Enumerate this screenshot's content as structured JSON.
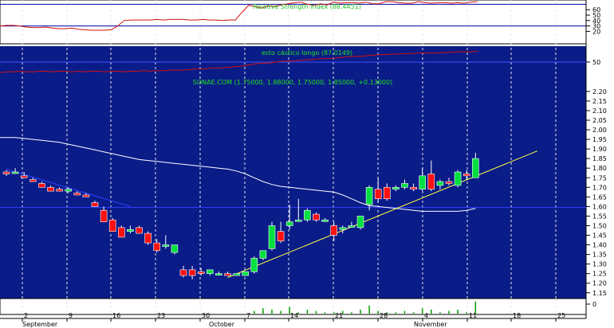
{
  "chart_data": [
    {
      "type": "line",
      "title": "Relative Strength Index (88.4451)",
      "ylim": [
        0,
        75
      ],
      "yticks": [
        20,
        30,
        40,
        50,
        60
      ],
      "reference_lines": [
        30,
        70
      ],
      "series": [
        {
          "values": [
            30,
            31,
            31,
            30,
            28,
            27,
            27,
            28,
            26,
            25,
            25,
            26,
            24,
            23,
            22,
            22,
            22,
            23,
            30,
            40,
            41,
            41,
            41,
            41,
            42,
            41,
            42,
            42,
            42,
            41,
            41,
            42,
            41,
            41,
            40,
            41,
            41,
            55,
            68,
            66,
            63,
            67,
            66,
            69,
            71,
            73,
            74,
            70,
            68,
            71,
            69,
            74,
            72,
            73,
            73,
            72,
            74,
            71,
            71,
            75,
            75,
            73,
            72,
            72,
            75,
            73,
            72,
            73,
            73,
            72,
            73,
            72,
            74,
            75
          ]
        }
      ]
    },
    {
      "type": "line",
      "title": "esto cástico longo (87.0149)",
      "ylim": [
        25,
        75
      ],
      "yticks": [
        50
      ],
      "series": [
        {
          "values": [
            32,
            33,
            33,
            34,
            33,
            33,
            34,
            34,
            33,
            34,
            34,
            33,
            34,
            33,
            34,
            34,
            33,
            34,
            34,
            33,
            34,
            34,
            35,
            34,
            35,
            35,
            36,
            36,
            36,
            37,
            38,
            38,
            39,
            40,
            40,
            41,
            42,
            43,
            45,
            47,
            48,
            48,
            50,
            51,
            52,
            52,
            53,
            54,
            55,
            56,
            56,
            57,
            58,
            59,
            60,
            60,
            61,
            62,
            63,
            63,
            64,
            64,
            65,
            65,
            66,
            66,
            66,
            66,
            67,
            67,
            68,
            68,
            68,
            69
          ]
        }
      ]
    },
    {
      "type": "candlestick",
      "title": "SONAE.COM (1.75000, 1.88000, 1.75000, 1.85000, +0.13000)",
      "ylim": [
        1.12,
        2.27
      ],
      "yticks": [
        "2.20",
        "2.15",
        "2.10",
        "2.05",
        "2.00",
        "1.95",
        "1.90",
        "1.85",
        "1.80",
        "1.75",
        "1.70",
        "1.65",
        "1.60",
        "1.55",
        "1.50",
        "1.45",
        "1.40",
        "1.35",
        "1.30",
        "1.25",
        "1.20",
        "1.15"
      ],
      "x_ticks": [
        "2",
        "9",
        "16",
        "23",
        "30",
        "7",
        "14",
        "21",
        "28",
        "4",
        "11",
        "18",
        "25"
      ],
      "months": [
        "September",
        "October",
        "November"
      ],
      "candles": [
        {
          "o": 1.78,
          "h": 1.79,
          "l": 1.76,
          "c": 1.77
        },
        {
          "o": 1.78,
          "h": 1.8,
          "l": 1.77,
          "c": 1.78
        },
        {
          "o": 1.76,
          "h": 1.78,
          "l": 1.75,
          "c": 1.75
        },
        {
          "o": 1.74,
          "h": 1.75,
          "l": 1.73,
          "c": 1.73
        },
        {
          "o": 1.72,
          "h": 1.73,
          "l": 1.7,
          "c": 1.7
        },
        {
          "o": 1.7,
          "h": 1.71,
          "l": 1.68,
          "c": 1.68
        },
        {
          "o": 1.69,
          "h": 1.7,
          "l": 1.68,
          "c": 1.68
        },
        {
          "o": 1.68,
          "h": 1.7,
          "l": 1.67,
          "c": 1.69
        },
        {
          "o": 1.67,
          "h": 1.68,
          "l": 1.66,
          "c": 1.66
        },
        {
          "o": 1.66,
          "h": 1.67,
          "l": 1.65,
          "c": 1.65
        },
        {
          "o": 1.62,
          "h": 1.63,
          "l": 1.6,
          "c": 1.6
        },
        {
          "o": 1.58,
          "h": 1.6,
          "l": 1.52,
          "c": 1.52
        },
        {
          "o": 1.53,
          "h": 1.54,
          "l": 1.47,
          "c": 1.47
        },
        {
          "o": 1.49,
          "h": 1.5,
          "l": 1.44,
          "c": 1.44
        },
        {
          "o": 1.47,
          "h": 1.5,
          "l": 1.46,
          "c": 1.48
        },
        {
          "o": 1.49,
          "h": 1.5,
          "l": 1.46,
          "c": 1.46
        },
        {
          "o": 1.46,
          "h": 1.47,
          "l": 1.4,
          "c": 1.41
        },
        {
          "o": 1.41,
          "h": 1.43,
          "l": 1.36,
          "c": 1.37
        },
        {
          "o": 1.4,
          "h": 1.45,
          "l": 1.38,
          "c": 1.4
        },
        {
          "o": 1.36,
          "h": 1.4,
          "l": 1.35,
          "c": 1.4
        },
        {
          "o": 1.27,
          "h": 1.29,
          "l": 1.23,
          "c": 1.24
        },
        {
          "o": 1.27,
          "h": 1.29,
          "l": 1.22,
          "c": 1.24
        },
        {
          "o": 1.26,
          "h": 1.28,
          "l": 1.24,
          "c": 1.25
        },
        {
          "o": 1.25,
          "h": 1.27,
          "l": 1.24,
          "c": 1.27
        },
        {
          "o": 1.25,
          "h": 1.26,
          "l": 1.24,
          "c": 1.25
        },
        {
          "o": 1.25,
          "h": 1.26,
          "l": 1.24,
          "c": 1.24
        },
        {
          "o": 1.24,
          "h": 1.25,
          "l": 1.24,
          "c": 1.25
        },
        {
          "o": 1.24,
          "h": 1.26,
          "l": 1.24,
          "c": 1.26
        },
        {
          "o": 1.26,
          "h": 1.34,
          "l": 1.25,
          "c": 1.33
        },
        {
          "o": 1.33,
          "h": 1.37,
          "l": 1.32,
          "c": 1.37
        },
        {
          "o": 1.38,
          "h": 1.52,
          "l": 1.37,
          "c": 1.5
        },
        {
          "o": 1.47,
          "h": 1.52,
          "l": 1.41,
          "c": 1.42
        },
        {
          "o": 1.5,
          "h": 1.61,
          "l": 1.48,
          "c": 1.52
        },
        {
          "o": 1.53,
          "h": 1.64,
          "l": 1.52,
          "c": 1.53
        },
        {
          "o": 1.53,
          "h": 1.59,
          "l": 1.52,
          "c": 1.58
        },
        {
          "o": 1.56,
          "h": 1.57,
          "l": 1.52,
          "c": 1.53
        },
        {
          "o": 1.53,
          "h": 1.54,
          "l": 1.52,
          "c": 1.53
        },
        {
          "o": 1.5,
          "h": 1.52,
          "l": 1.42,
          "c": 1.45
        },
        {
          "o": 1.48,
          "h": 1.5,
          "l": 1.46,
          "c": 1.49
        },
        {
          "o": 1.5,
          "h": 1.52,
          "l": 1.49,
          "c": 1.5
        },
        {
          "o": 1.49,
          "h": 1.55,
          "l": 1.48,
          "c": 1.55
        },
        {
          "o": 1.61,
          "h": 1.71,
          "l": 1.58,
          "c": 1.7
        },
        {
          "o": 1.69,
          "h": 1.75,
          "l": 1.62,
          "c": 1.64
        },
        {
          "o": 1.7,
          "h": 1.72,
          "l": 1.63,
          "c": 1.64
        },
        {
          "o": 1.69,
          "h": 1.71,
          "l": 1.68,
          "c": 1.7
        },
        {
          "o": 1.7,
          "h": 1.74,
          "l": 1.69,
          "c": 1.72
        },
        {
          "o": 1.7,
          "h": 1.72,
          "l": 1.68,
          "c": 1.69
        },
        {
          "o": 1.69,
          "h": 1.8,
          "l": 1.68,
          "c": 1.76
        },
        {
          "o": 1.77,
          "h": 1.84,
          "l": 1.68,
          "c": 1.69
        },
        {
          "o": 1.71,
          "h": 1.74,
          "l": 1.69,
          "c": 1.73
        },
        {
          "o": 1.73,
          "h": 1.75,
          "l": 1.71,
          "c": 1.72
        },
        {
          "o": 1.71,
          "h": 1.79,
          "l": 1.7,
          "c": 1.78
        },
        {
          "o": 1.77,
          "h": 1.79,
          "l": 1.74,
          "c": 1.76
        },
        {
          "o": 1.75,
          "h": 1.88,
          "l": 1.75,
          "c": 1.85
        }
      ],
      "moving_average": [
        1.96,
        1.96,
        1.955,
        1.95,
        1.945,
        1.94,
        1.935,
        1.925,
        1.915,
        1.905,
        1.895,
        1.885,
        1.875,
        1.865,
        1.855,
        1.845,
        1.84,
        1.835,
        1.83,
        1.825,
        1.82,
        1.815,
        1.81,
        1.805,
        1.8,
        1.795,
        1.785,
        1.77,
        1.75,
        1.73,
        1.715,
        1.705,
        1.7,
        1.695,
        1.69,
        1.685,
        1.68,
        1.675,
        1.66,
        1.64,
        1.62,
        1.605,
        1.6,
        1.595,
        1.59,
        1.585,
        1.58,
        1.575,
        1.575,
        1.575,
        1.575,
        1.575,
        1.58,
        1.59
      ],
      "horizontal_line": 1.595,
      "trendlines": [
        {
          "from": [
            0,
            1.795
          ],
          "to": [
            14,
            1.6
          ]
        },
        {
          "from": [
            25,
            1.23
          ],
          "to": [
            60,
            1.89
          ]
        }
      ]
    },
    {
      "type": "bar",
      "yticks": [
        "0"
      ],
      "values": [
        0,
        0,
        0,
        0,
        0,
        0,
        0,
        0,
        0,
        0,
        0,
        0,
        0,
        0,
        0,
        0,
        0,
        0,
        0,
        0,
        0,
        0,
        0,
        0,
        0,
        0,
        0,
        0,
        2,
        4,
        3,
        2,
        5,
        1,
        3,
        2,
        1,
        1,
        2,
        1,
        3,
        6,
        2,
        1,
        1,
        2,
        1,
        4,
        3,
        1,
        2,
        3,
        1,
        9
      ]
    }
  ],
  "colors": {
    "panel_bg": "#0a1c88",
    "grid": "#e8e8e8",
    "up": "#00e040",
    "down": "#ff1010",
    "line": "#d01010",
    "trend": "#ffff40",
    "ma": "#ffffff",
    "title": "#20e020"
  }
}
